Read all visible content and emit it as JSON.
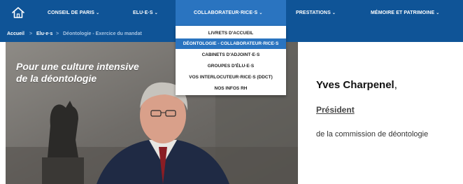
{
  "nav": {
    "home_icon": "home-icon",
    "items": [
      {
        "label": "CONSEIL DE PARIS"
      },
      {
        "label": "ELU·E·S"
      },
      {
        "label": "COLLABORATEUR·RICE·S"
      },
      {
        "label": "PRESTATIONS"
      },
      {
        "label": "MÉMOIRE ET PATRIMOINE"
      }
    ],
    "chevron": "⌄",
    "active_color": "#2a74c0",
    "bar_color": "#0f5497"
  },
  "breadcrumb": {
    "items": [
      "Accueil",
      "Elu·e·s",
      "Déontologie - Exercice du mandat"
    ],
    "separator": ">"
  },
  "dropdown": {
    "items": [
      {
        "label": "LIVRETS D'ACCUEIL"
      },
      {
        "label": "DÉONTOLOGIE - COLLABORATEUR·RICE·S"
      },
      {
        "label": "CABINETS D'ADJOINT·E·S"
      },
      {
        "label": "GROUPES D'ÉLU·E·S"
      },
      {
        "label": "VOS INTERLOCUTEUR·RICE·S (DDCT)"
      },
      {
        "label": "NOS INFOS RH"
      }
    ],
    "selected_index": 1
  },
  "hero": {
    "title_line1": "Pour une culture intensive",
    "title_line2": "de la déontologie"
  },
  "person": {
    "name": "Yves Charpenel",
    "name_suffix": ",",
    "role": "Président",
    "description": "de la commission de déontologie"
  }
}
